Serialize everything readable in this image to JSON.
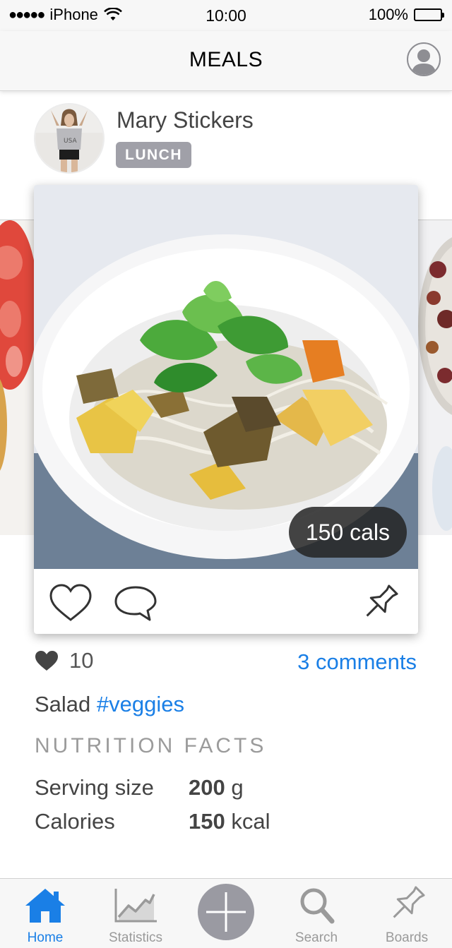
{
  "status_bar": {
    "carrier": "iPhone",
    "time": "10:00",
    "battery": "100%"
  },
  "nav": {
    "title": "MEALS"
  },
  "post": {
    "user_name": "Mary Stickers",
    "meal_type": "LUNCH",
    "calories_badge": "150 cals",
    "likes_count": "10",
    "comments_link": "3 comments",
    "caption_text": "Salad",
    "caption_hashtag": "#veggies"
  },
  "nutrition": {
    "title": "NUTRITION FACTS",
    "rows": [
      {
        "label": "Serving size",
        "value": "200",
        "unit": "g"
      },
      {
        "label": "Calories",
        "value": "150",
        "unit": "kcal"
      }
    ]
  },
  "tabbar": {
    "items": [
      {
        "label": "Home",
        "icon": "home-icon",
        "active": true
      },
      {
        "label": "Statistics",
        "icon": "chart-icon",
        "active": false
      },
      {
        "label": "",
        "icon": "plus-icon",
        "active": false
      },
      {
        "label": "Search",
        "icon": "search-icon",
        "active": false
      },
      {
        "label": "Boards",
        "icon": "pin-icon",
        "active": false
      }
    ]
  },
  "colors": {
    "accent": "#1a7fe6",
    "badge": "#a0a0a8",
    "inactive_tab": "#9a9a9a",
    "bar_background": "#f7f7f7"
  }
}
